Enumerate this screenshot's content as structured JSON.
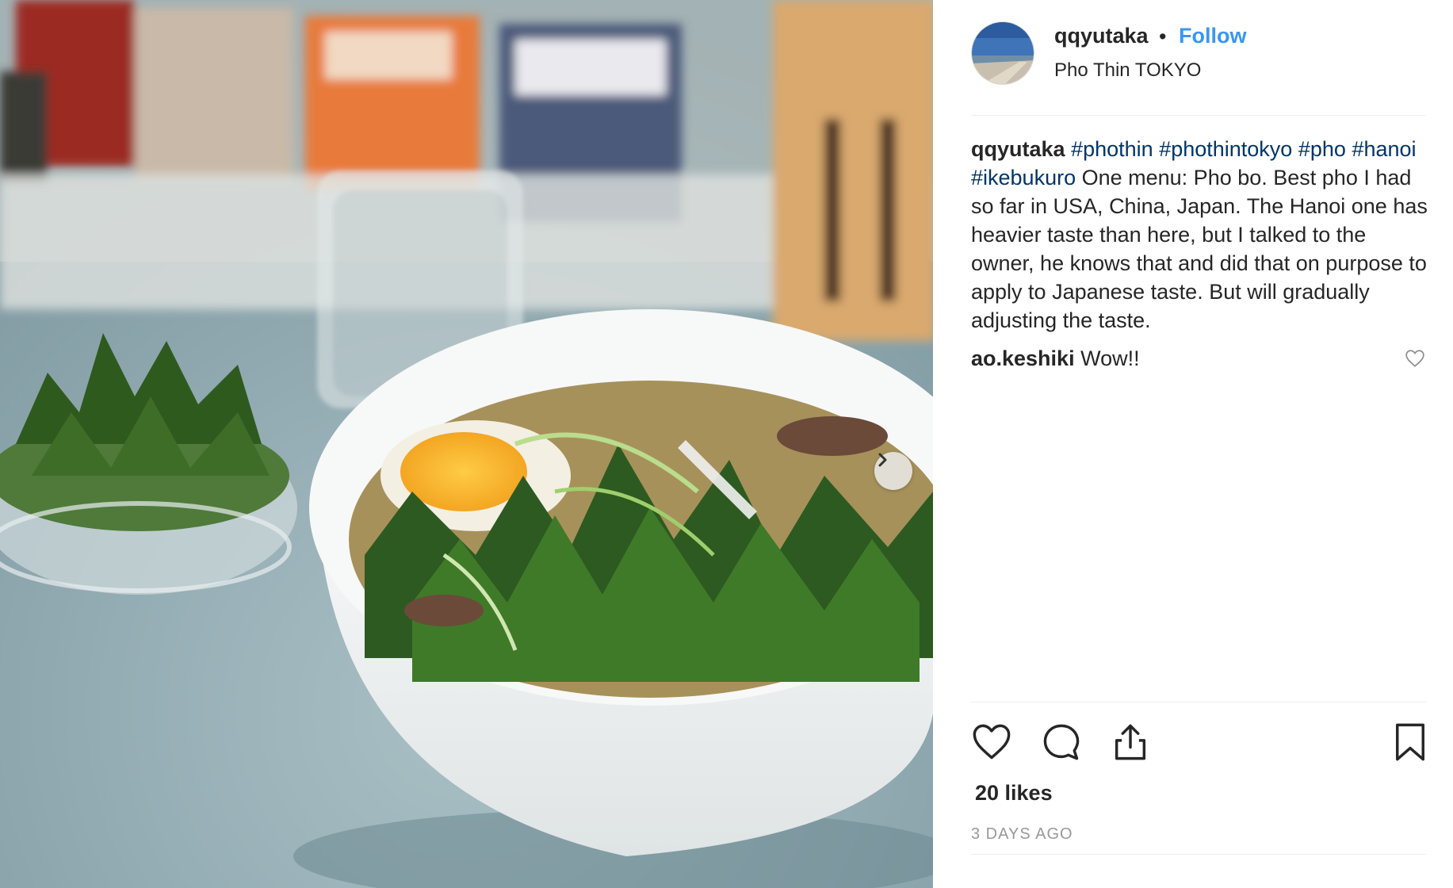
{
  "post": {
    "username": "qqyutaka",
    "separator": "•",
    "follow_label": "Follow",
    "location": "Pho Thin TOKYO"
  },
  "caption": {
    "username": "qqyutaka",
    "hashtags": [
      "#phothin",
      "#phothintokyo",
      "#pho",
      "#hanoi",
      "#ikebukuro"
    ],
    "text": "One menu: Pho bo. Best pho I had so far in USA, China, Japan. The Hanoi one has heavier taste than here, but I talked to the owner, he knows that and did that on purpose to apply to Japanese taste. But will gradually adjusting the taste."
  },
  "comments": [
    {
      "username": "ao.keshiki",
      "text": "Wow!!"
    }
  ],
  "stats": {
    "likes": "20 likes",
    "timestamp": "3 DAYS AGO"
  },
  "icons": {
    "next": "chevron-right-icon",
    "like": "heart-icon",
    "comment": "speech-bubble-icon",
    "share": "share-icon",
    "save": "bookmark-icon",
    "comment_like": "heart-icon"
  },
  "colors": {
    "link_blue": "#3897f0",
    "hashtag": "#003569",
    "text": "#262626",
    "muted": "#999999",
    "divider": "#efefef"
  }
}
